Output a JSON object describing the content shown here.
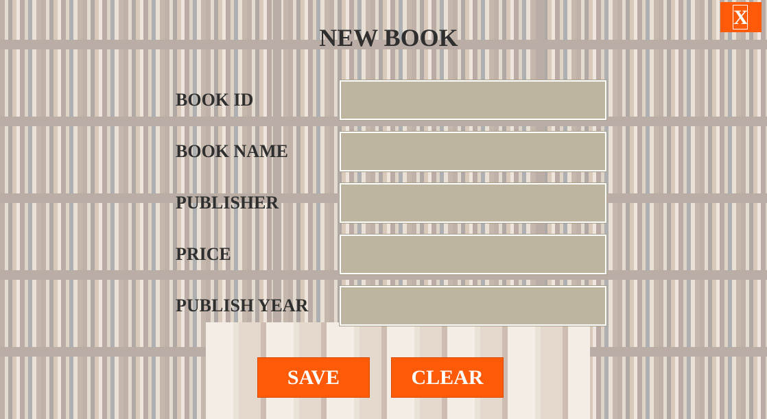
{
  "window": {
    "title": "NEW BOOK",
    "close_label": "X"
  },
  "form": {
    "fields": [
      {
        "label": "BOOK ID",
        "value": "",
        "placeholder": ""
      },
      {
        "label": "BOOK NAME",
        "value": "",
        "placeholder": ""
      },
      {
        "label": "PUBLISHER",
        "value": "",
        "placeholder": ""
      },
      {
        "label": "PRICE",
        "value": "",
        "placeholder": ""
      },
      {
        "label": "PUBLISH YEAR",
        "value": "",
        "placeholder": ""
      }
    ]
  },
  "actions": {
    "save_label": "SAVE",
    "clear_label": "CLEAR"
  },
  "colors": {
    "accent": "#ff5a08",
    "input_fill": "#bdb59f",
    "text": "#2f2f2f"
  }
}
